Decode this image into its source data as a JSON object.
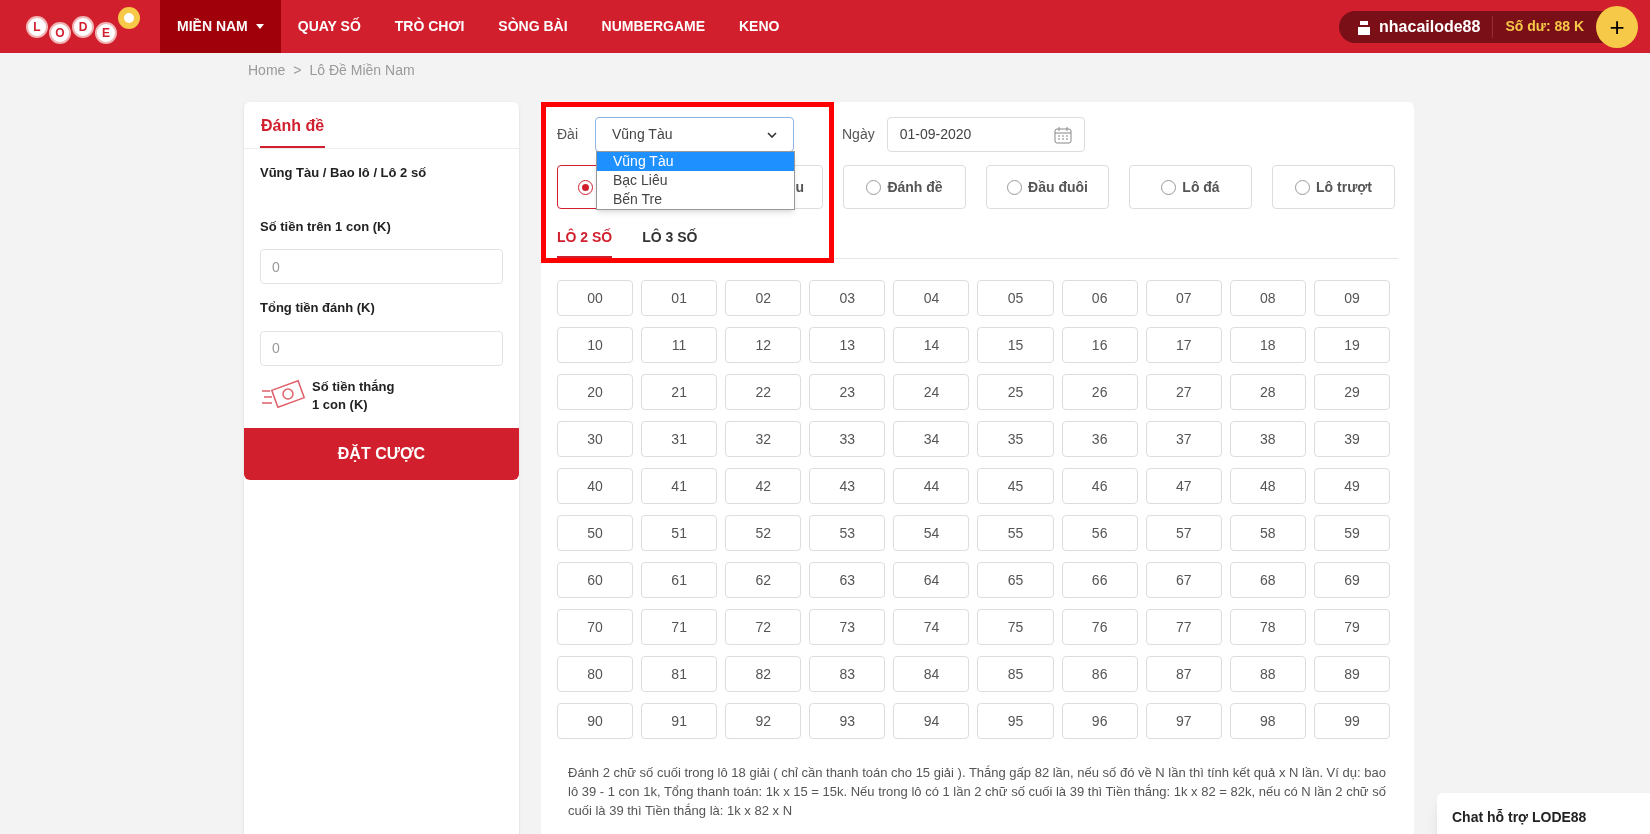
{
  "nav": {
    "logo_letters": [
      "L",
      "O",
      "D",
      "E"
    ],
    "items": [
      {
        "label": "MIỀN NAM",
        "selected": true,
        "dropdown": true
      },
      {
        "label": "QUAY SỐ",
        "selected": false,
        "dropdown": false
      },
      {
        "label": "TRÒ CHƠI",
        "selected": false,
        "dropdown": false
      },
      {
        "label": "SÒNG BÀI",
        "selected": false,
        "dropdown": false
      },
      {
        "label": "NUMBERGAME",
        "selected": false,
        "dropdown": false
      },
      {
        "label": "KENO",
        "selected": false,
        "dropdown": false
      }
    ],
    "user": "nhacailode88",
    "balance": "Số dư: 88 K",
    "add": "+"
  },
  "breadcrumb": {
    "items": [
      "Home",
      "Lô Đề Miền Nam"
    ],
    "separator": ">"
  },
  "bet_panel": {
    "title": "Đánh đề",
    "summary": "Vũng Tàu / Bao lô / Lô 2 số",
    "fields": [
      {
        "label": "Số tiền trên 1 con (K)",
        "placeholder": "0"
      },
      {
        "label": "Tổng tiền đánh (K)",
        "placeholder": "0"
      }
    ],
    "win_label": "Số tiền thắng",
    "win_label_2": "1 con (K)",
    "submit": "ĐẶT CƯỢC"
  },
  "form": {
    "station_label": "Đài",
    "station_value": "Vũng Tàu",
    "station_options": [
      {
        "label": "Vũng Tàu",
        "selected": true
      },
      {
        "label": "Bạc Liêu",
        "selected": false
      },
      {
        "label": "Bến Tre",
        "selected": false
      }
    ],
    "date_label": "Ngày",
    "date_value": "01-09-2020",
    "bet_types": [
      {
        "selected": true
      },
      {
        "label": "u",
        "selected": false
      },
      {
        "label": "Đánh đề",
        "selected": false
      },
      {
        "label": "Đầu đuôi",
        "selected": false
      },
      {
        "label": "Lô đá",
        "selected": false
      },
      {
        "label": "Lô trượt",
        "selected": false
      }
    ],
    "tabs": [
      {
        "label": "LÔ 2 SỐ",
        "selected": true
      },
      {
        "label": "LÔ 3 SỐ",
        "selected": false
      }
    ],
    "numbers": [
      {
        "n": "00",
        "selected": false
      },
      {
        "n": "01",
        "selected": false
      },
      {
        "n": "02",
        "selected": false
      },
      {
        "n": "03",
        "selected": false
      },
      {
        "n": "04",
        "selected": false
      },
      {
        "n": "05",
        "selected": false
      },
      {
        "n": "06",
        "selected": false
      },
      {
        "n": "07",
        "selected": false
      },
      {
        "n": "08",
        "selected": false
      },
      {
        "n": "09",
        "selected": false
      },
      {
        "n": "10",
        "selected": false
      },
      {
        "n": "11",
        "selected": false
      },
      {
        "n": "12",
        "selected": false
      },
      {
        "n": "13",
        "selected": false
      },
      {
        "n": "14",
        "selected": false
      },
      {
        "n": "15",
        "selected": false
      },
      {
        "n": "16",
        "selected": false
      },
      {
        "n": "17",
        "selected": false
      },
      {
        "n": "18",
        "selected": false
      },
      {
        "n": "19",
        "selected": false
      },
      {
        "n": "20",
        "selected": false
      },
      {
        "n": "21",
        "selected": false
      },
      {
        "n": "22",
        "selected": false
      },
      {
        "n": "23",
        "selected": false
      },
      {
        "n": "24",
        "selected": false
      },
      {
        "n": "25",
        "selected": false
      },
      {
        "n": "26",
        "selected": false
      },
      {
        "n": "27",
        "selected": false
      },
      {
        "n": "28",
        "selected": false
      },
      {
        "n": "29",
        "selected": false
      },
      {
        "n": "30",
        "selected": false
      },
      {
        "n": "31",
        "selected": false
      },
      {
        "n": "32",
        "selected": false
      },
      {
        "n": "33",
        "selected": false
      },
      {
        "n": "34",
        "selected": false
      },
      {
        "n": "35",
        "selected": false
      },
      {
        "n": "36",
        "selected": false
      },
      {
        "n": "37",
        "selected": false
      },
      {
        "n": "38",
        "selected": false
      },
      {
        "n": "39",
        "selected": false
      },
      {
        "n": "40",
        "selected": false
      },
      {
        "n": "41",
        "selected": false
      },
      {
        "n": "42",
        "selected": false
      },
      {
        "n": "43",
        "selected": false
      },
      {
        "n": "44",
        "selected": false
      },
      {
        "n": "45",
        "selected": false
      },
      {
        "n": "46",
        "selected": false
      },
      {
        "n": "47",
        "selected": false
      },
      {
        "n": "48",
        "selected": false
      },
      {
        "n": "49",
        "selected": false
      },
      {
        "n": "50",
        "selected": false
      },
      {
        "n": "51",
        "selected": false
      },
      {
        "n": "52",
        "selected": false
      },
      {
        "n": "53",
        "selected": false
      },
      {
        "n": "54",
        "selected": false
      },
      {
        "n": "55",
        "selected": false
      },
      {
        "n": "56",
        "selected": false
      },
      {
        "n": "57",
        "selected": false
      },
      {
        "n": "58",
        "selected": false
      },
      {
        "n": "59",
        "selected": false
      },
      {
        "n": "60",
        "selected": false
      },
      {
        "n": "61",
        "selected": false
      },
      {
        "n": "62",
        "selected": false
      },
      {
        "n": "63",
        "selected": false
      },
      {
        "n": "64",
        "selected": false
      },
      {
        "n": "65",
        "selected": false
      },
      {
        "n": "66",
        "selected": false
      },
      {
        "n": "67",
        "selected": false
      },
      {
        "n": "68",
        "selected": false
      },
      {
        "n": "69",
        "selected": false
      },
      {
        "n": "70",
        "selected": false
      },
      {
        "n": "71",
        "selected": false
      },
      {
        "n": "72",
        "selected": false
      },
      {
        "n": "73",
        "selected": false
      },
      {
        "n": "74",
        "selected": false
      },
      {
        "n": "75",
        "selected": false
      },
      {
        "n": "76",
        "selected": false
      },
      {
        "n": "77",
        "selected": false
      },
      {
        "n": "78",
        "selected": false
      },
      {
        "n": "79",
        "selected": false
      },
      {
        "n": "80",
        "selected": false
      },
      {
        "n": "81",
        "selected": false
      },
      {
        "n": "82",
        "selected": false
      },
      {
        "n": "83",
        "selected": false
      },
      {
        "n": "84",
        "selected": false
      },
      {
        "n": "85",
        "selected": false
      },
      {
        "n": "86",
        "selected": false
      },
      {
        "n": "87",
        "selected": false
      },
      {
        "n": "88",
        "selected": false
      },
      {
        "n": "89",
        "selected": false
      },
      {
        "n": "90",
        "selected": false
      },
      {
        "n": "91",
        "selected": false
      },
      {
        "n": "92",
        "selected": false
      },
      {
        "n": "93",
        "selected": false
      },
      {
        "n": "94",
        "selected": false
      },
      {
        "n": "95",
        "selected": false
      },
      {
        "n": "96",
        "selected": false
      },
      {
        "n": "97",
        "selected": false
      },
      {
        "n": "98",
        "selected": false
      },
      {
        "n": "99",
        "selected": false
      }
    ],
    "description": "Đánh 2 chữ số cuối trong lô 18 giải ( chỉ cần thanh toán cho 15 giải ). Thắng gấp 82 lần, nếu số đó về N lần thì tính kết quả x N lần. Ví dụ: bao lô 39 - 1 con 1k, Tổng thanh toán: 1k x 15 = 15k. Nếu trong lô có 1 lần 2 chữ số cuối là 39 thì Tiền thắng: 1k x 82 = 82k, nếu có N lần 2 chữ số cuối là 39 thì Tiền thắng là: 1k x 82 x N"
  },
  "chat": {
    "title": "Chat hỗ trợ LODE88"
  }
}
